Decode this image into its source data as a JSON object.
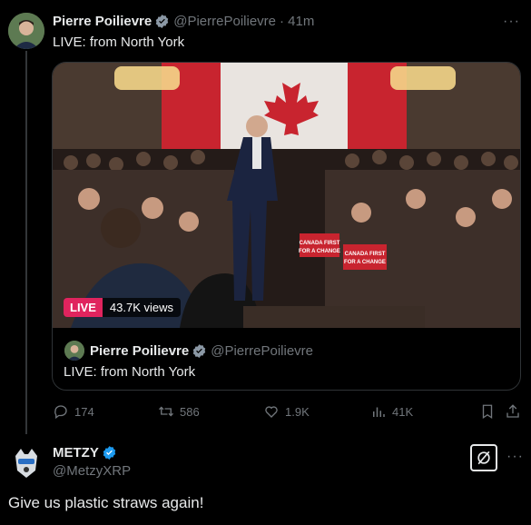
{
  "tweet": {
    "author_name": "Pierre Poilievre",
    "handle": "@PierrePoilievre",
    "time": "· 41m",
    "text": "LIVE: from North York",
    "more": "···"
  },
  "media": {
    "live_label": "LIVE",
    "views": "43.7K views",
    "signs": [
      "CANADA FIRST FOR A CHANGE",
      "CANADA FIRST FOR A CHANGE"
    ]
  },
  "card": {
    "author_name": "Pierre Poilievre",
    "handle": "@PierrePoilievre",
    "text": "LIVE: from North York"
  },
  "actions": {
    "replies": "174",
    "reposts": "586",
    "likes": "1.9K",
    "views": "41K"
  },
  "reply": {
    "author_name": "METZY",
    "handle": "@MetzyXRP",
    "text": "Give us plastic straws again!",
    "more": "···"
  },
  "colors": {
    "verified_gray": "#8b98a5",
    "verified_blue": "#1d9bf0",
    "live_red": "#e0245e",
    "muted": "#71767b"
  }
}
